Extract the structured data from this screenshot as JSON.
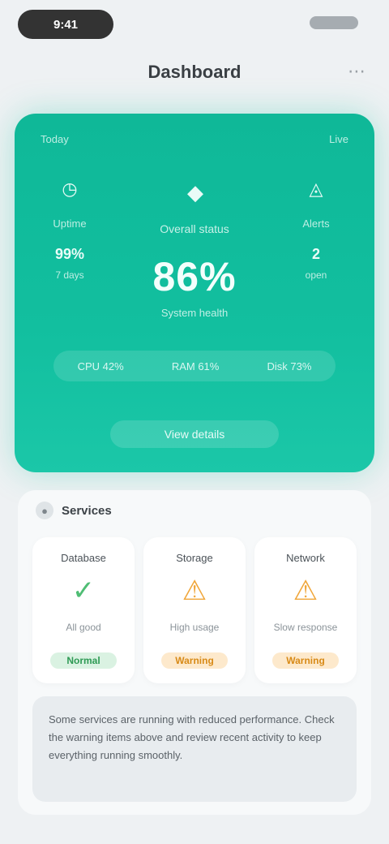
{
  "status_bar": {
    "time": "9:41"
  },
  "nav": {
    "title": "Dashboard",
    "more_icon": "more-icon"
  },
  "hero": {
    "label_left": "Today",
    "label_right": "Live",
    "top_caption": "Overall status",
    "center_value": "86%",
    "center_sub": "System health",
    "left_metric": {
      "label": "Uptime",
      "value": "99%",
      "sub": "7 days"
    },
    "right_metric": {
      "label": "Alerts",
      "value": "2",
      "sub": "open"
    },
    "strip_items": [
      "CPU 42%",
      "RAM 61%",
      "Disk 73%"
    ],
    "cta_label": "View details"
  },
  "section": {
    "title": "Services",
    "cards": [
      {
        "title": "Database",
        "sub": "All good",
        "badge": "Normal"
      },
      {
        "title": "Storage",
        "sub": "High usage",
        "badge": "Warning"
      },
      {
        "title": "Network",
        "sub": "Slow response",
        "badge": "Warning"
      }
    ],
    "note": "Some services are running with reduced performance. Check the warning items above and review recent activity to keep everything running smoothly."
  }
}
